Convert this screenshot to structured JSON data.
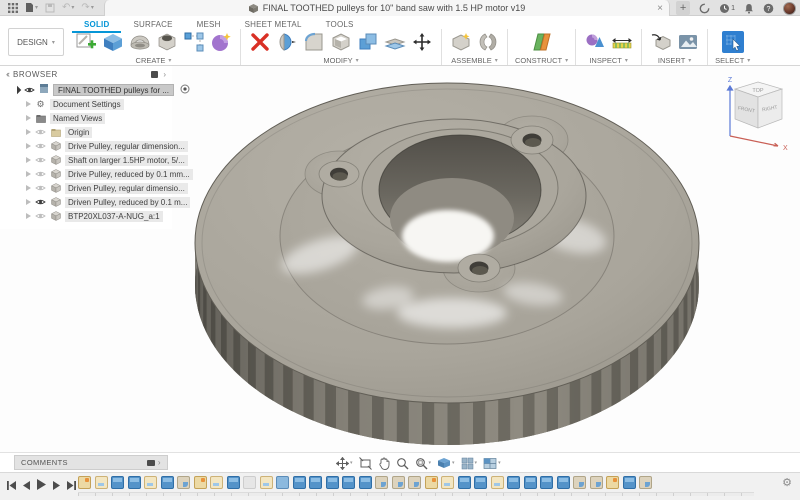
{
  "titlebar": {
    "title": "FINAL TOOTHED pulleys for 10\" band saw with 1.5 HP motor v19",
    "notification_count": "1",
    "close_label": "×",
    "new_tab_label": "+"
  },
  "workspace": {
    "label": "DESIGN"
  },
  "toolbar": {
    "tabs": [
      {
        "label": "SOLID",
        "active": true
      },
      {
        "label": "SURFACE",
        "active": false
      },
      {
        "label": "MESH",
        "active": false
      },
      {
        "label": "SHEET METAL",
        "active": false
      },
      {
        "label": "TOOLS",
        "active": false
      }
    ],
    "groups": [
      {
        "label": "CREATE"
      },
      {
        "label": "MODIFY"
      },
      {
        "label": "ASSEMBLE"
      },
      {
        "label": "CONSTRUCT"
      },
      {
        "label": "INSPECT"
      },
      {
        "label": "INSERT"
      },
      {
        "label": "SELECT"
      }
    ]
  },
  "browser": {
    "header": "BROWSER",
    "root_label": "FINAL TOOTHED pulleys for ...",
    "items": [
      {
        "label": "Document Settings",
        "icon": "gear",
        "eye": null
      },
      {
        "label": "Named Views",
        "icon": "views",
        "eye": null
      },
      {
        "label": "Origin",
        "icon": "folder",
        "eye": "off"
      },
      {
        "label": "Drive Pulley, regular dimension...",
        "icon": "component",
        "eye": "off"
      },
      {
        "label": "Shaft on larger 1.5HP motor, 5/...",
        "icon": "component",
        "eye": "off"
      },
      {
        "label": "Drive Pulley, reduced by 0.1 mm...",
        "icon": "component",
        "eye": "off"
      },
      {
        "label": "Driven Pulley, regular dimensio...",
        "icon": "component",
        "eye": "off"
      },
      {
        "label": "Driven Pulley, reduced by 0.1 m...",
        "icon": "component",
        "eye": "on"
      },
      {
        "label": "BTP20XL037-A-NUG_a:1",
        "icon": "component",
        "eye": "off"
      }
    ]
  },
  "viewcube": {
    "top": "TOP",
    "front": "FRONT",
    "right": "RIGHT",
    "z_axis": "Z",
    "x_axis": "X"
  },
  "footer": {
    "comments_label": "COMMENTS"
  },
  "timeline": {
    "features": [
      "sketch",
      "construction",
      "extrude",
      "extrude",
      "construction",
      "extrude",
      "fillet",
      "sketch",
      "construction",
      "extrude",
      "disabled",
      "construction",
      "mirror",
      "extrude",
      "extrude",
      "extrude",
      "extrude",
      "extrude",
      "fillet",
      "fillet",
      "fillet",
      "sketch",
      "construction",
      "extrude",
      "extrude",
      "construction",
      "extrude",
      "extrude",
      "extrude",
      "extrude",
      "fillet",
      "fillet",
      "sketch",
      "extrude",
      "fillet"
    ]
  },
  "pulley": {
    "teeth": 62,
    "face_color": "#a9a59b",
    "side_color": "#8f8b81",
    "groove_color": "#6e6b62",
    "accent_blue": "#0696d7"
  }
}
